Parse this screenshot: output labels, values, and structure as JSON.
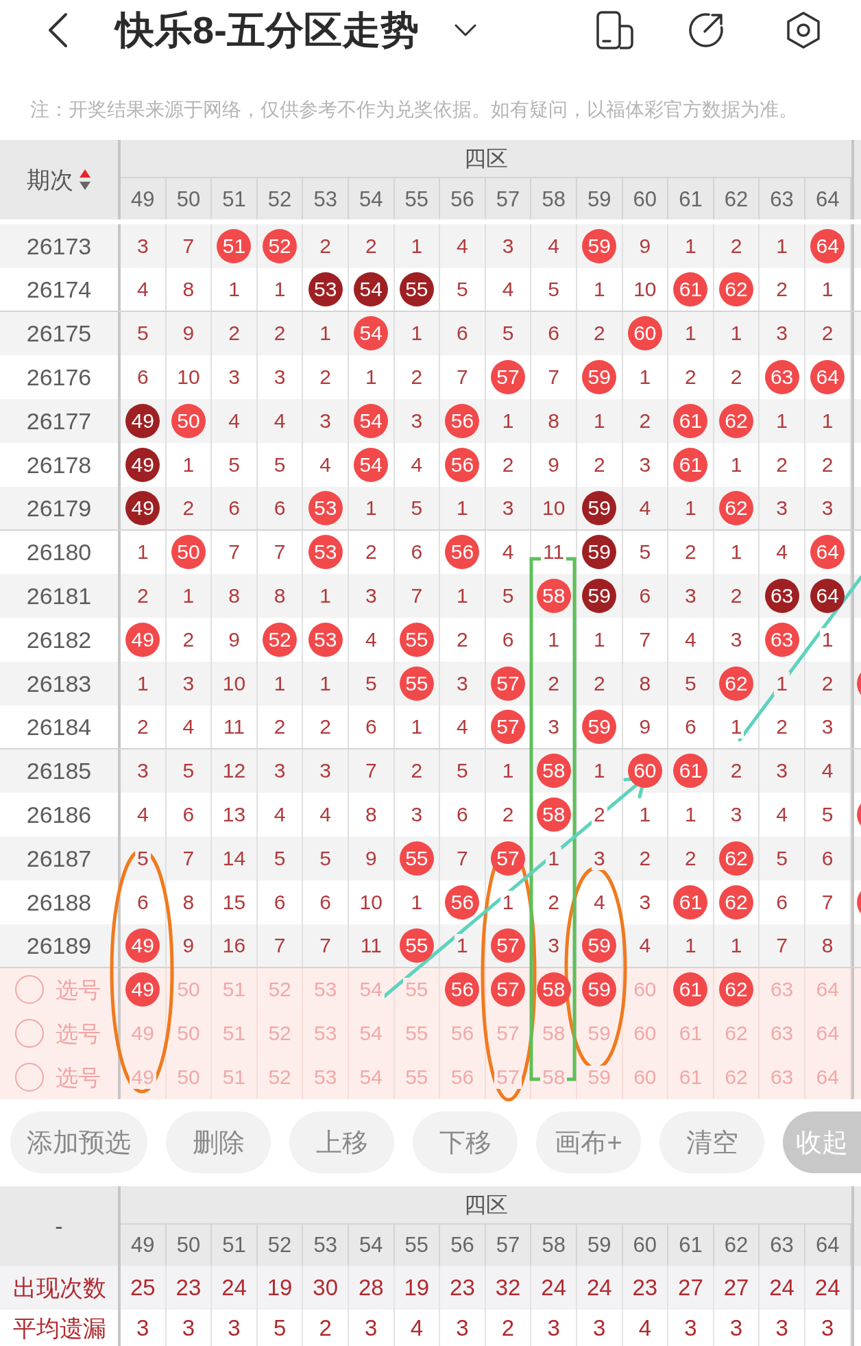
{
  "header": {
    "title": "快乐8-五分区走势"
  },
  "notice": "注：开奖结果来源于网络，仅供参考不作为兑奖依据。如有疑问，以福体彩官方数据为准。",
  "trend_table": {
    "period_heading": "期次",
    "sort_ascending": true,
    "zone": "四区",
    "columns": [
      "49",
      "50",
      "51",
      "52",
      "53",
      "54",
      "55",
      "56",
      "57",
      "58",
      "59",
      "60",
      "61",
      "62",
      "63",
      "64"
    ],
    "rows": [
      {
        "period": "26173",
        "cut_off_hit": false,
        "cells": [
          {
            "kind": "miss",
            "text": "3"
          },
          {
            "kind": "miss",
            "text": "7"
          },
          {
            "kind": "hit",
            "text": "51"
          },
          {
            "kind": "hit",
            "text": "52"
          },
          {
            "kind": "miss",
            "text": "2"
          },
          {
            "kind": "miss",
            "text": "2"
          },
          {
            "kind": "miss",
            "text": "1"
          },
          {
            "kind": "miss",
            "text": "4"
          },
          {
            "kind": "miss",
            "text": "3"
          },
          {
            "kind": "miss",
            "text": "4"
          },
          {
            "kind": "hit",
            "text": "59"
          },
          {
            "kind": "miss",
            "text": "9"
          },
          {
            "kind": "miss",
            "text": "1"
          },
          {
            "kind": "miss",
            "text": "2"
          },
          {
            "kind": "miss",
            "text": "1"
          },
          {
            "kind": "hit",
            "text": "64"
          }
        ]
      },
      {
        "period": "26174",
        "cut_off_hit": false,
        "cells": [
          {
            "kind": "miss",
            "text": "4"
          },
          {
            "kind": "miss",
            "text": "8"
          },
          {
            "kind": "miss",
            "text": "1"
          },
          {
            "kind": "miss",
            "text": "1"
          },
          {
            "kind": "repeat",
            "text": "53"
          },
          {
            "kind": "repeat",
            "text": "54"
          },
          {
            "kind": "repeat",
            "text": "55"
          },
          {
            "kind": "miss",
            "text": "5"
          },
          {
            "kind": "miss",
            "text": "4"
          },
          {
            "kind": "miss",
            "text": "5"
          },
          {
            "kind": "miss",
            "text": "1"
          },
          {
            "kind": "miss",
            "text": "10"
          },
          {
            "kind": "hit",
            "text": "61"
          },
          {
            "kind": "hit",
            "text": "62"
          },
          {
            "kind": "miss",
            "text": "2"
          },
          {
            "kind": "miss",
            "text": "1"
          }
        ]
      },
      {
        "period": "26175",
        "cut_off_hit": false,
        "cells": [
          {
            "kind": "miss",
            "text": "5"
          },
          {
            "kind": "miss",
            "text": "9"
          },
          {
            "kind": "miss",
            "text": "2"
          },
          {
            "kind": "miss",
            "text": "2"
          },
          {
            "kind": "miss",
            "text": "1"
          },
          {
            "kind": "hit",
            "text": "54"
          },
          {
            "kind": "miss",
            "text": "1"
          },
          {
            "kind": "miss",
            "text": "6"
          },
          {
            "kind": "miss",
            "text": "5"
          },
          {
            "kind": "miss",
            "text": "6"
          },
          {
            "kind": "miss",
            "text": "2"
          },
          {
            "kind": "hit",
            "text": "60"
          },
          {
            "kind": "miss",
            "text": "1"
          },
          {
            "kind": "miss",
            "text": "1"
          },
          {
            "kind": "miss",
            "text": "3"
          },
          {
            "kind": "miss",
            "text": "2"
          }
        ]
      },
      {
        "period": "26176",
        "cut_off_hit": false,
        "cells": [
          {
            "kind": "miss",
            "text": "6"
          },
          {
            "kind": "miss",
            "text": "10"
          },
          {
            "kind": "miss",
            "text": "3"
          },
          {
            "kind": "miss",
            "text": "3"
          },
          {
            "kind": "miss",
            "text": "2"
          },
          {
            "kind": "miss",
            "text": "1"
          },
          {
            "kind": "miss",
            "text": "2"
          },
          {
            "kind": "miss",
            "text": "7"
          },
          {
            "kind": "hit",
            "text": "57"
          },
          {
            "kind": "miss",
            "text": "7"
          },
          {
            "kind": "hit",
            "text": "59"
          },
          {
            "kind": "miss",
            "text": "1"
          },
          {
            "kind": "miss",
            "text": "2"
          },
          {
            "kind": "miss",
            "text": "2"
          },
          {
            "kind": "hit",
            "text": "63"
          },
          {
            "kind": "hit",
            "text": "64"
          }
        ]
      },
      {
        "period": "26177",
        "cut_off_hit": false,
        "cells": [
          {
            "kind": "repeat",
            "text": "49"
          },
          {
            "kind": "hit",
            "text": "50"
          },
          {
            "kind": "miss",
            "text": "4"
          },
          {
            "kind": "miss",
            "text": "4"
          },
          {
            "kind": "miss",
            "text": "3"
          },
          {
            "kind": "hit",
            "text": "54"
          },
          {
            "kind": "miss",
            "text": "3"
          },
          {
            "kind": "hit",
            "text": "56"
          },
          {
            "kind": "miss",
            "text": "1"
          },
          {
            "kind": "miss",
            "text": "8"
          },
          {
            "kind": "miss",
            "text": "1"
          },
          {
            "kind": "miss",
            "text": "2"
          },
          {
            "kind": "hit",
            "text": "61"
          },
          {
            "kind": "hit",
            "text": "62"
          },
          {
            "kind": "miss",
            "text": "1"
          },
          {
            "kind": "miss",
            "text": "1"
          }
        ]
      },
      {
        "period": "26178",
        "cut_off_hit": false,
        "cells": [
          {
            "kind": "repeat",
            "text": "49"
          },
          {
            "kind": "miss",
            "text": "1"
          },
          {
            "kind": "miss",
            "text": "5"
          },
          {
            "kind": "miss",
            "text": "5"
          },
          {
            "kind": "miss",
            "text": "4"
          },
          {
            "kind": "hit",
            "text": "54"
          },
          {
            "kind": "miss",
            "text": "4"
          },
          {
            "kind": "hit",
            "text": "56"
          },
          {
            "kind": "miss",
            "text": "2"
          },
          {
            "kind": "miss",
            "text": "9"
          },
          {
            "kind": "miss",
            "text": "2"
          },
          {
            "kind": "miss",
            "text": "3"
          },
          {
            "kind": "hit",
            "text": "61"
          },
          {
            "kind": "miss",
            "text": "1"
          },
          {
            "kind": "miss",
            "text": "2"
          },
          {
            "kind": "miss",
            "text": "2"
          }
        ]
      },
      {
        "period": "26179",
        "cut_off_hit": false,
        "cells": [
          {
            "kind": "repeat",
            "text": "49"
          },
          {
            "kind": "miss",
            "text": "2"
          },
          {
            "kind": "miss",
            "text": "6"
          },
          {
            "kind": "miss",
            "text": "6"
          },
          {
            "kind": "hit",
            "text": "53"
          },
          {
            "kind": "miss",
            "text": "1"
          },
          {
            "kind": "miss",
            "text": "5"
          },
          {
            "kind": "miss",
            "text": "1"
          },
          {
            "kind": "miss",
            "text": "3"
          },
          {
            "kind": "miss",
            "text": "10"
          },
          {
            "kind": "repeat",
            "text": "59"
          },
          {
            "kind": "miss",
            "text": "4"
          },
          {
            "kind": "miss",
            "text": "1"
          },
          {
            "kind": "hit",
            "text": "62"
          },
          {
            "kind": "miss",
            "text": "3"
          },
          {
            "kind": "miss",
            "text": "3"
          }
        ]
      },
      {
        "period": "26180",
        "cut_off_hit": false,
        "cells": [
          {
            "kind": "miss",
            "text": "1"
          },
          {
            "kind": "hit",
            "text": "50"
          },
          {
            "kind": "miss",
            "text": "7"
          },
          {
            "kind": "miss",
            "text": "7"
          },
          {
            "kind": "hit",
            "text": "53"
          },
          {
            "kind": "miss",
            "text": "2"
          },
          {
            "kind": "miss",
            "text": "6"
          },
          {
            "kind": "hit",
            "text": "56"
          },
          {
            "kind": "miss",
            "text": "4"
          },
          {
            "kind": "miss",
            "text": "11"
          },
          {
            "kind": "repeat",
            "text": "59"
          },
          {
            "kind": "miss",
            "text": "5"
          },
          {
            "kind": "miss",
            "text": "2"
          },
          {
            "kind": "miss",
            "text": "1"
          },
          {
            "kind": "miss",
            "text": "4"
          },
          {
            "kind": "hit",
            "text": "64"
          }
        ]
      },
      {
        "period": "26181",
        "cut_off_hit": false,
        "cells": [
          {
            "kind": "miss",
            "text": "2"
          },
          {
            "kind": "miss",
            "text": "1"
          },
          {
            "kind": "miss",
            "text": "8"
          },
          {
            "kind": "miss",
            "text": "8"
          },
          {
            "kind": "miss",
            "text": "1"
          },
          {
            "kind": "miss",
            "text": "3"
          },
          {
            "kind": "miss",
            "text": "7"
          },
          {
            "kind": "miss",
            "text": "1"
          },
          {
            "kind": "miss",
            "text": "5"
          },
          {
            "kind": "hit",
            "text": "58"
          },
          {
            "kind": "repeat",
            "text": "59"
          },
          {
            "kind": "miss",
            "text": "6"
          },
          {
            "kind": "miss",
            "text": "3"
          },
          {
            "kind": "miss",
            "text": "2"
          },
          {
            "kind": "repeat",
            "text": "63"
          },
          {
            "kind": "repeat",
            "text": "64"
          }
        ]
      },
      {
        "period": "26182",
        "cut_off_hit": false,
        "cells": [
          {
            "kind": "hit",
            "text": "49"
          },
          {
            "kind": "miss",
            "text": "2"
          },
          {
            "kind": "miss",
            "text": "9"
          },
          {
            "kind": "hit",
            "text": "52"
          },
          {
            "kind": "hit",
            "text": "53"
          },
          {
            "kind": "miss",
            "text": "4"
          },
          {
            "kind": "hit",
            "text": "55"
          },
          {
            "kind": "miss",
            "text": "2"
          },
          {
            "kind": "miss",
            "text": "6"
          },
          {
            "kind": "miss",
            "text": "1"
          },
          {
            "kind": "miss",
            "text": "1"
          },
          {
            "kind": "miss",
            "text": "7"
          },
          {
            "kind": "miss",
            "text": "4"
          },
          {
            "kind": "miss",
            "text": "3"
          },
          {
            "kind": "hit",
            "text": "63"
          },
          {
            "kind": "miss",
            "text": "1"
          }
        ]
      },
      {
        "period": "26183",
        "cut_off_hit": true,
        "cells": [
          {
            "kind": "miss",
            "text": "1"
          },
          {
            "kind": "miss",
            "text": "3"
          },
          {
            "kind": "miss",
            "text": "10"
          },
          {
            "kind": "miss",
            "text": "1"
          },
          {
            "kind": "miss",
            "text": "1"
          },
          {
            "kind": "miss",
            "text": "5"
          },
          {
            "kind": "hit",
            "text": "55"
          },
          {
            "kind": "miss",
            "text": "3"
          },
          {
            "kind": "hit",
            "text": "57"
          },
          {
            "kind": "miss",
            "text": "2"
          },
          {
            "kind": "miss",
            "text": "2"
          },
          {
            "kind": "miss",
            "text": "8"
          },
          {
            "kind": "miss",
            "text": "5"
          },
          {
            "kind": "hit",
            "text": "62"
          },
          {
            "kind": "miss",
            "text": "1"
          },
          {
            "kind": "miss",
            "text": "2"
          }
        ]
      },
      {
        "period": "26184",
        "cut_off_hit": false,
        "cells": [
          {
            "kind": "miss",
            "text": "2"
          },
          {
            "kind": "miss",
            "text": "4"
          },
          {
            "kind": "miss",
            "text": "11"
          },
          {
            "kind": "miss",
            "text": "2"
          },
          {
            "kind": "miss",
            "text": "2"
          },
          {
            "kind": "miss",
            "text": "6"
          },
          {
            "kind": "miss",
            "text": "1"
          },
          {
            "kind": "miss",
            "text": "4"
          },
          {
            "kind": "hit",
            "text": "57"
          },
          {
            "kind": "miss",
            "text": "3"
          },
          {
            "kind": "hit",
            "text": "59"
          },
          {
            "kind": "miss",
            "text": "9"
          },
          {
            "kind": "miss",
            "text": "6"
          },
          {
            "kind": "miss",
            "text": "1"
          },
          {
            "kind": "miss",
            "text": "2"
          },
          {
            "kind": "miss",
            "text": "3"
          }
        ]
      },
      {
        "period": "26185",
        "cut_off_hit": false,
        "cells": [
          {
            "kind": "miss",
            "text": "3"
          },
          {
            "kind": "miss",
            "text": "5"
          },
          {
            "kind": "miss",
            "text": "12"
          },
          {
            "kind": "miss",
            "text": "3"
          },
          {
            "kind": "miss",
            "text": "3"
          },
          {
            "kind": "miss",
            "text": "7"
          },
          {
            "kind": "miss",
            "text": "2"
          },
          {
            "kind": "miss",
            "text": "5"
          },
          {
            "kind": "miss",
            "text": "1"
          },
          {
            "kind": "hit",
            "text": "58"
          },
          {
            "kind": "miss",
            "text": "1"
          },
          {
            "kind": "hit",
            "text": "60"
          },
          {
            "kind": "hit",
            "text": "61"
          },
          {
            "kind": "miss",
            "text": "2"
          },
          {
            "kind": "miss",
            "text": "3"
          },
          {
            "kind": "miss",
            "text": "4"
          }
        ]
      },
      {
        "period": "26186",
        "cut_off_hit": true,
        "cells": [
          {
            "kind": "miss",
            "text": "4"
          },
          {
            "kind": "miss",
            "text": "6"
          },
          {
            "kind": "miss",
            "text": "13"
          },
          {
            "kind": "miss",
            "text": "4"
          },
          {
            "kind": "miss",
            "text": "4"
          },
          {
            "kind": "miss",
            "text": "8"
          },
          {
            "kind": "miss",
            "text": "3"
          },
          {
            "kind": "miss",
            "text": "6"
          },
          {
            "kind": "miss",
            "text": "2"
          },
          {
            "kind": "hit",
            "text": "58"
          },
          {
            "kind": "miss",
            "text": "2"
          },
          {
            "kind": "miss",
            "text": "1"
          },
          {
            "kind": "miss",
            "text": "1"
          },
          {
            "kind": "miss",
            "text": "3"
          },
          {
            "kind": "miss",
            "text": "4"
          },
          {
            "kind": "miss",
            "text": "5"
          }
        ]
      },
      {
        "period": "26187",
        "cut_off_hit": false,
        "cells": [
          {
            "kind": "miss",
            "text": "5"
          },
          {
            "kind": "miss",
            "text": "7"
          },
          {
            "kind": "miss",
            "text": "14"
          },
          {
            "kind": "miss",
            "text": "5"
          },
          {
            "kind": "miss",
            "text": "5"
          },
          {
            "kind": "miss",
            "text": "9"
          },
          {
            "kind": "hit",
            "text": "55"
          },
          {
            "kind": "miss",
            "text": "7"
          },
          {
            "kind": "hit",
            "text": "57"
          },
          {
            "kind": "miss",
            "text": "1"
          },
          {
            "kind": "miss",
            "text": "3"
          },
          {
            "kind": "miss",
            "text": "2"
          },
          {
            "kind": "miss",
            "text": "2"
          },
          {
            "kind": "hit",
            "text": "62"
          },
          {
            "kind": "miss",
            "text": "5"
          },
          {
            "kind": "miss",
            "text": "6"
          }
        ]
      },
      {
        "period": "26188",
        "cut_off_hit": true,
        "cells": [
          {
            "kind": "miss",
            "text": "6"
          },
          {
            "kind": "miss",
            "text": "8"
          },
          {
            "kind": "miss",
            "text": "15"
          },
          {
            "kind": "miss",
            "text": "6"
          },
          {
            "kind": "miss",
            "text": "6"
          },
          {
            "kind": "miss",
            "text": "10"
          },
          {
            "kind": "miss",
            "text": "1"
          },
          {
            "kind": "hit",
            "text": "56"
          },
          {
            "kind": "miss",
            "text": "1"
          },
          {
            "kind": "miss",
            "text": "2"
          },
          {
            "kind": "miss",
            "text": "4"
          },
          {
            "kind": "miss",
            "text": "3"
          },
          {
            "kind": "hit",
            "text": "61"
          },
          {
            "kind": "hit",
            "text": "62"
          },
          {
            "kind": "miss",
            "text": "6"
          },
          {
            "kind": "miss",
            "text": "7"
          }
        ]
      },
      {
        "period": "26189",
        "cut_off_hit": false,
        "cells": [
          {
            "kind": "hit",
            "text": "49"
          },
          {
            "kind": "miss",
            "text": "9"
          },
          {
            "kind": "miss",
            "text": "16"
          },
          {
            "kind": "miss",
            "text": "7"
          },
          {
            "kind": "miss",
            "text": "7"
          },
          {
            "kind": "miss",
            "text": "11"
          },
          {
            "kind": "hit",
            "text": "55"
          },
          {
            "kind": "miss",
            "text": "1"
          },
          {
            "kind": "hit",
            "text": "57"
          },
          {
            "kind": "miss",
            "text": "3"
          },
          {
            "kind": "hit",
            "text": "59"
          },
          {
            "kind": "miss",
            "text": "4"
          },
          {
            "kind": "miss",
            "text": "1"
          },
          {
            "kind": "miss",
            "text": "1"
          },
          {
            "kind": "miss",
            "text": "7"
          },
          {
            "kind": "miss",
            "text": "8"
          }
        ]
      }
    ],
    "pick_rows": [
      {
        "checked": false,
        "label": "选号",
        "cells": [
          {
            "text": "49",
            "selected": true
          },
          {
            "text": "50",
            "selected": false
          },
          {
            "text": "51",
            "selected": false
          },
          {
            "text": "52",
            "selected": false
          },
          {
            "text": "53",
            "selected": false
          },
          {
            "text": "54",
            "selected": false
          },
          {
            "text": "55",
            "selected": false
          },
          {
            "text": "56",
            "selected": true
          },
          {
            "text": "57",
            "selected": true
          },
          {
            "text": "58",
            "selected": true
          },
          {
            "text": "59",
            "selected": true
          },
          {
            "text": "60",
            "selected": false
          },
          {
            "text": "61",
            "selected": true
          },
          {
            "text": "62",
            "selected": true
          },
          {
            "text": "63",
            "selected": false
          },
          {
            "text": "64",
            "selected": false
          }
        ]
      },
      {
        "checked": false,
        "label": "选号",
        "cells": [
          {
            "text": "49",
            "selected": false
          },
          {
            "text": "50",
            "selected": false
          },
          {
            "text": "51",
            "selected": false
          },
          {
            "text": "52",
            "selected": false
          },
          {
            "text": "53",
            "selected": false
          },
          {
            "text": "54",
            "selected": false
          },
          {
            "text": "55",
            "selected": false
          },
          {
            "text": "56",
            "selected": false
          },
          {
            "text": "57",
            "selected": false
          },
          {
            "text": "58",
            "selected": false
          },
          {
            "text": "59",
            "selected": false
          },
          {
            "text": "60",
            "selected": false
          },
          {
            "text": "61",
            "selected": false
          },
          {
            "text": "62",
            "selected": false
          },
          {
            "text": "63",
            "selected": false
          },
          {
            "text": "64",
            "selected": false
          }
        ]
      },
      {
        "checked": false,
        "label": "选号",
        "cells": [
          {
            "text": "49",
            "selected": false
          },
          {
            "text": "50",
            "selected": false
          },
          {
            "text": "51",
            "selected": false
          },
          {
            "text": "52",
            "selected": false
          },
          {
            "text": "53",
            "selected": false
          },
          {
            "text": "54",
            "selected": false
          },
          {
            "text": "55",
            "selected": false
          },
          {
            "text": "56",
            "selected": false
          },
          {
            "text": "57",
            "selected": false
          },
          {
            "text": "58",
            "selected": false
          },
          {
            "text": "59",
            "selected": false
          },
          {
            "text": "60",
            "selected": false
          },
          {
            "text": "61",
            "selected": false
          },
          {
            "text": "62",
            "selected": false
          },
          {
            "text": "63",
            "selected": false
          },
          {
            "text": "64",
            "selected": false
          }
        ]
      }
    ]
  },
  "buttons": [
    {
      "label": "添加预选",
      "active": false
    },
    {
      "label": "删除",
      "active": false
    },
    {
      "label": "上移",
      "active": false
    },
    {
      "label": "下移",
      "active": false
    },
    {
      "label": "画布+",
      "active": false
    },
    {
      "label": "清空",
      "active": false
    },
    {
      "label": "收起",
      "active": true
    }
  ],
  "stats_table": {
    "corner": "-",
    "zone": "四区",
    "columns": [
      "49",
      "50",
      "51",
      "52",
      "53",
      "54",
      "55",
      "56",
      "57",
      "58",
      "59",
      "60",
      "61",
      "62",
      "63",
      "64"
    ],
    "rows": [
      {
        "label": "出现次数",
        "values": [
          "25",
          "23",
          "24",
          "19",
          "30",
          "28",
          "19",
          "23",
          "32",
          "24",
          "24",
          "23",
          "27",
          "27",
          "24",
          "24"
        ]
      },
      {
        "label": "平均遗漏",
        "values": [
          "3",
          "3",
          "3",
          "5",
          "2",
          "3",
          "4",
          "3",
          "2",
          "3",
          "3",
          "4",
          "3",
          "3",
          "3",
          "3"
        ]
      }
    ]
  }
}
